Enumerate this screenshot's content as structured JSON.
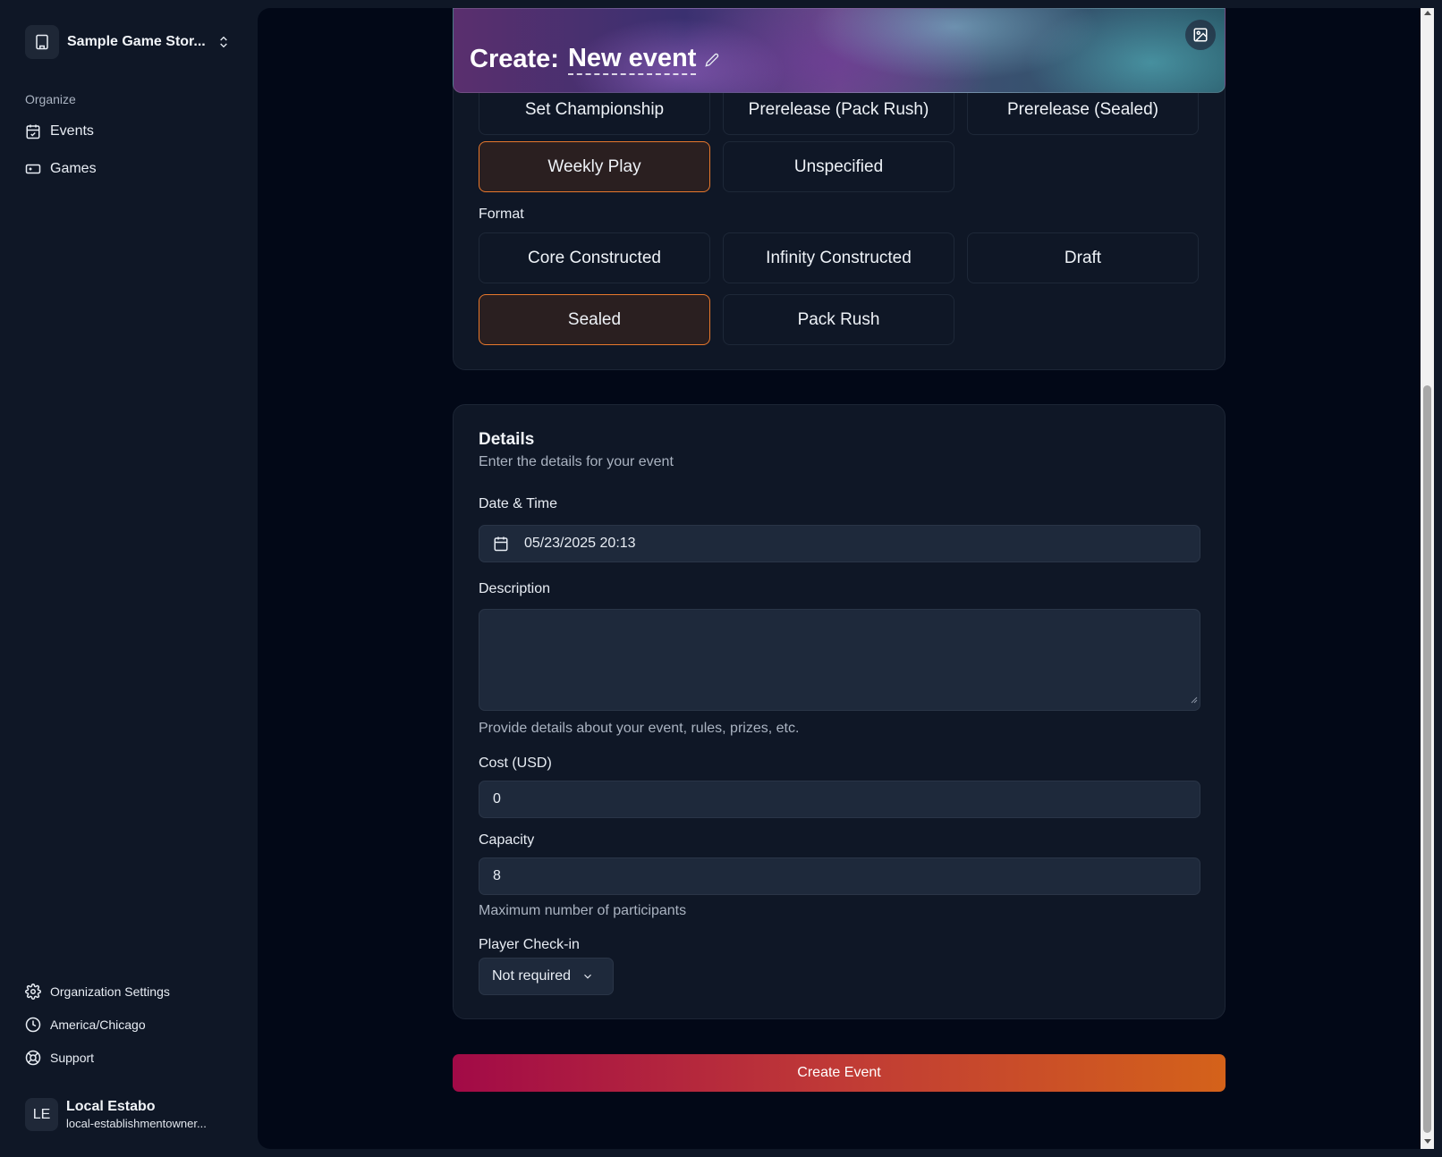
{
  "sidebar": {
    "store_name": "Sample Game Stor...",
    "section_label": "Organize",
    "nav": [
      {
        "label": "Events",
        "icon": "calendar-icon"
      },
      {
        "label": "Games",
        "icon": "gamepad-icon"
      }
    ],
    "bottom": [
      {
        "label": "Organization Settings",
        "icon": "gear-icon"
      },
      {
        "label": "America/Chicago",
        "icon": "clock-icon"
      },
      {
        "label": "Support",
        "icon": "lifebuoy-icon"
      }
    ],
    "user": {
      "initials": "LE",
      "name": "Local Estabo",
      "email": "local-establishmentowner..."
    }
  },
  "header": {
    "prefix": "Create:",
    "event_name": "New event"
  },
  "event_type": {
    "options_row1": [
      "Set Championship",
      "Prerelease (Pack Rush)",
      "Prerelease (Sealed)"
    ],
    "options_row2": [
      "Weekly Play",
      "Unspecified"
    ],
    "selected": "Weekly Play"
  },
  "format": {
    "label": "Format",
    "options_row1": [
      "Core Constructed",
      "Infinity Constructed",
      "Draft"
    ],
    "options_row2": [
      "Sealed",
      "Pack Rush"
    ],
    "selected": "Sealed"
  },
  "details": {
    "title": "Details",
    "subtitle": "Enter the details for your event",
    "date_label": "Date & Time",
    "date_value": "05/23/2025 20:13",
    "description_label": "Description",
    "description_value": "",
    "description_hint": "Provide details about your event, rules, prizes, etc.",
    "cost_label": "Cost (USD)",
    "cost_value": "0",
    "capacity_label": "Capacity",
    "capacity_value": "8",
    "capacity_hint": "Maximum number of participants",
    "checkin_label": "Player Check-in",
    "checkin_value": "Not required"
  },
  "actions": {
    "create_label": "Create Event"
  },
  "colors": {
    "accent_border": "#e8782c",
    "button_start": "#a20a47",
    "button_end": "#d4621a"
  }
}
